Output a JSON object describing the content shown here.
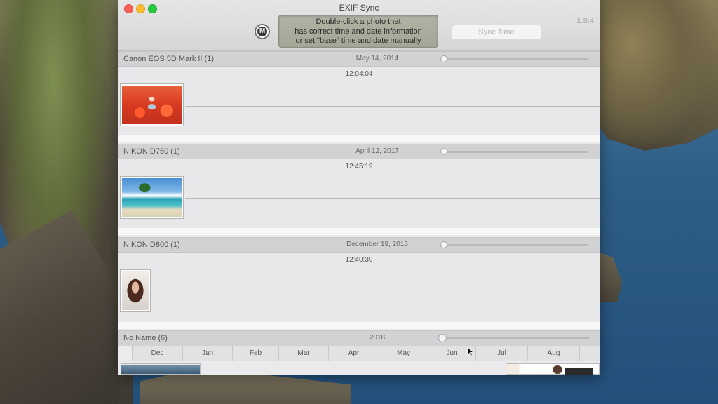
{
  "window": {
    "title": "EXIF Sync",
    "version": "1.8.4",
    "mode_button_label": "M",
    "instructions": [
      "Double-click a photo that",
      "has correct time and date information",
      "or set \"base\" time and date manually"
    ],
    "sync_button_label": "Sync Time"
  },
  "cameras": [
    {
      "name": "Canon EOS 5D Mark II (1)",
      "date": "May 14, 2014",
      "time": "12:04:04",
      "photo": "red-poppy-field-photo",
      "slider_position": 0
    },
    {
      "name": "NIKON D750 (1)",
      "date": "April 12, 2017",
      "time": "12:45:19",
      "photo": "tropical-beach-photo",
      "slider_position": 0
    },
    {
      "name": "NIKON D800 (1)",
      "date": "December 19, 2015",
      "time": "12:40:30",
      "photo": "woman-portrait-photo",
      "slider_position": 0
    },
    {
      "name": "No Name (6)",
      "date": "2018",
      "slider_position": 0
    }
  ],
  "timeline_months": [
    "Dec",
    "Jan",
    "Feb",
    "Mar",
    "Apr",
    "May",
    "Jun",
    "Jul",
    "Aug"
  ],
  "colors": {
    "close": "#fc5f57",
    "minimize": "#fdbc2e",
    "maximize": "#28c840"
  }
}
